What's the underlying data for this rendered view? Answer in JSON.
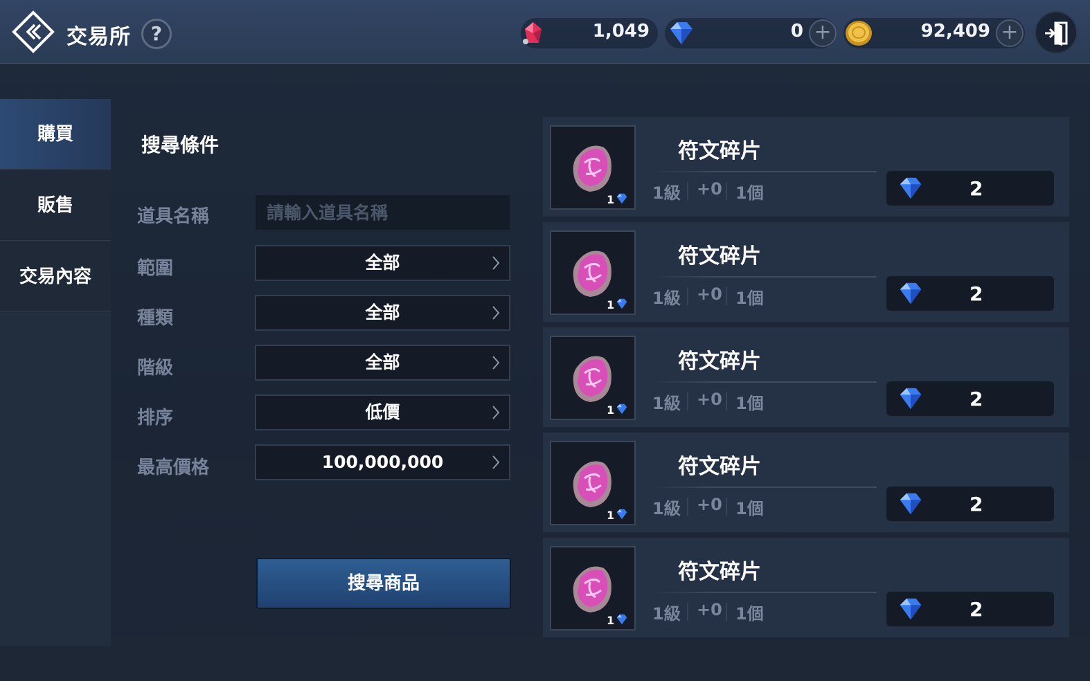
{
  "header": {
    "title": "交易所",
    "help_label": "?",
    "currencies": [
      {
        "name": "ruby",
        "value": "1,049"
      },
      {
        "name": "diamond",
        "value": "0"
      },
      {
        "name": "gold",
        "value": "92,409"
      }
    ],
    "plus_label": "+"
  },
  "sidebar": {
    "items": [
      {
        "label": "購買",
        "active": true
      },
      {
        "label": "販售",
        "active": false
      },
      {
        "label": "交易內容",
        "active": false
      }
    ]
  },
  "search": {
    "title": "搜尋條件",
    "item_name_label": "道具名稱",
    "item_name_placeholder": "請輸入道具名稱",
    "item_name_value": "",
    "filters": [
      {
        "label": "範圍",
        "value": "全部"
      },
      {
        "label": "種類",
        "value": "全部"
      },
      {
        "label": "階級",
        "value": "全部"
      },
      {
        "label": "排序",
        "value": "低價"
      },
      {
        "label": "最高價格",
        "value": "100,000,000"
      }
    ],
    "search_button": "搜尋商品"
  },
  "listings": [
    {
      "name": "符文碎片",
      "level": "1級",
      "enhance": "+0",
      "count": "1個",
      "thumb_qty": "1",
      "price": "2"
    },
    {
      "name": "符文碎片",
      "level": "1級",
      "enhance": "+0",
      "count": "1個",
      "thumb_qty": "1",
      "price": "2"
    },
    {
      "name": "符文碎片",
      "level": "1級",
      "enhance": "+0",
      "count": "1個",
      "thumb_qty": "1",
      "price": "2"
    },
    {
      "name": "符文碎片",
      "level": "1級",
      "enhance": "+0",
      "count": "1個",
      "thumb_qty": "1",
      "price": "2"
    },
    {
      "name": "符文碎片",
      "level": "1級",
      "enhance": "+0",
      "count": "1個",
      "thumb_qty": "1",
      "price": "2"
    }
  ],
  "colors": {
    "accent_blue": "#2f5e93",
    "header_bg": "#2f4260",
    "rune_pink": "#e04fc2",
    "gem_blue": "#3a7bf0",
    "gold": "#e0b23a",
    "ruby": "#e0305a"
  },
  "icons": {
    "back": "back-chevron-diamond-icon",
    "help": "question-icon",
    "exit": "exit-door-icon",
    "ruby": "ruby-gem-icon",
    "diamond": "blue-diamond-icon",
    "gold": "gold-coin-icon",
    "rune": "rune-stone-icon"
  }
}
